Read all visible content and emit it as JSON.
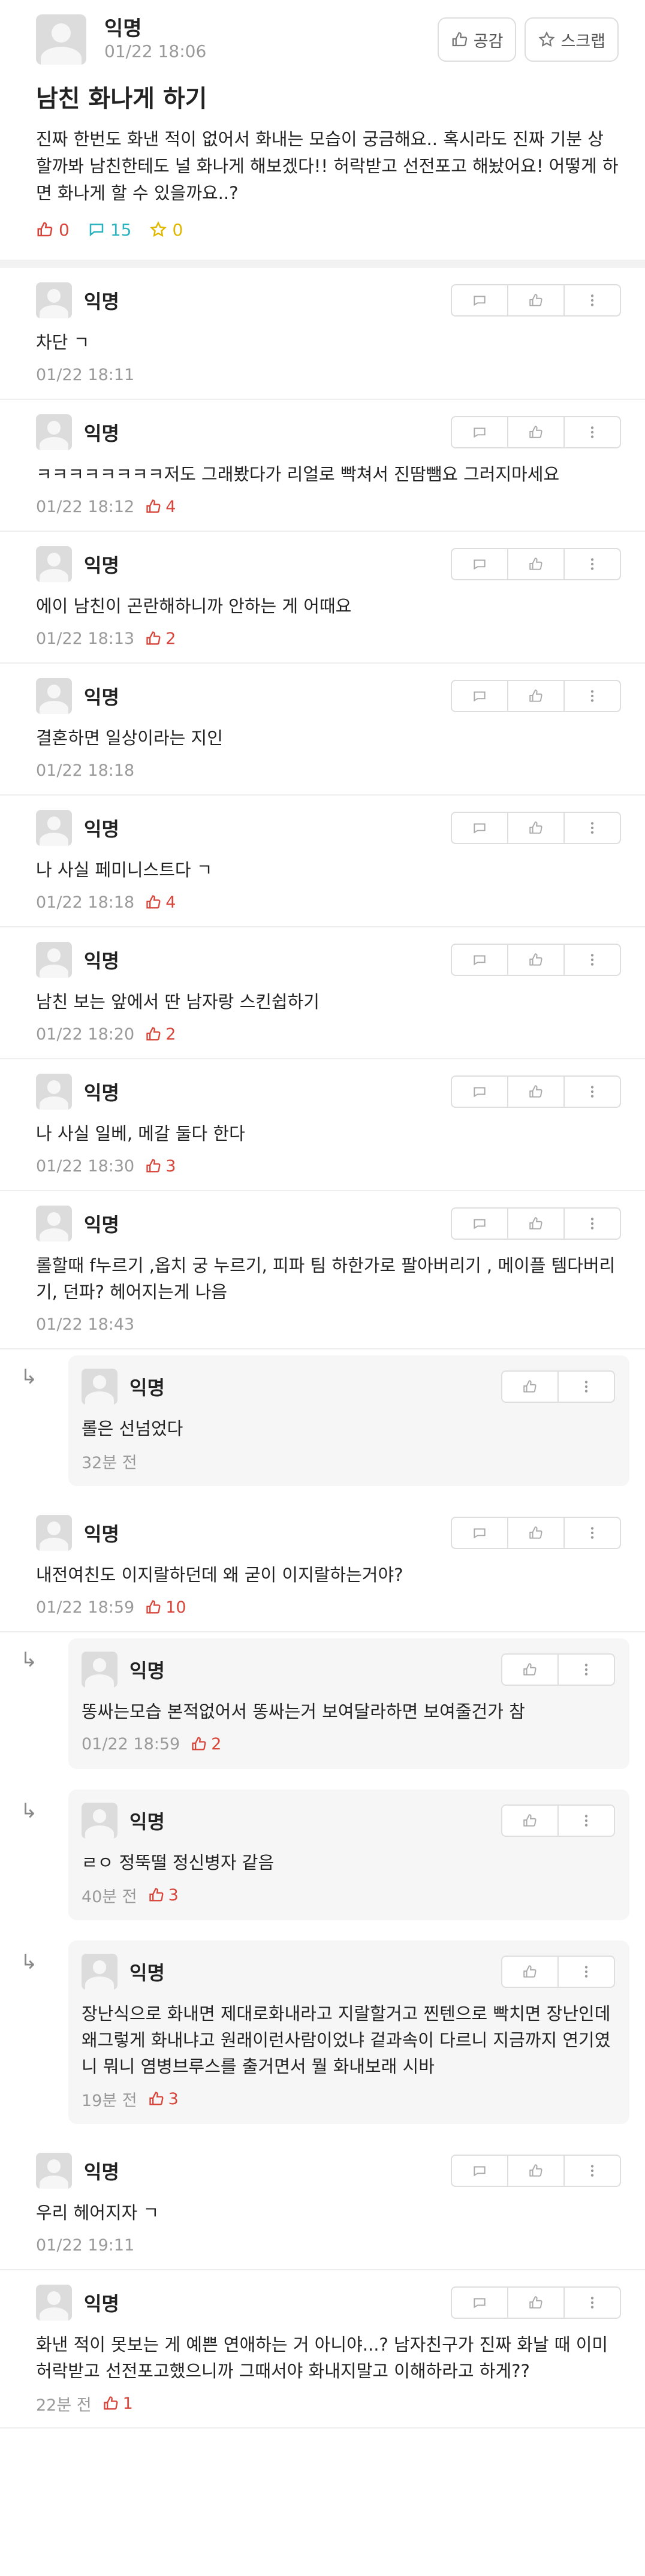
{
  "post": {
    "author": "익명",
    "time": "01/22 18:06",
    "like_button": "공감",
    "scrap_button": "스크랩",
    "title": "남친 화나게 하기",
    "content": "진짜 한번도 화낸 적이 없어서 화내는 모습이 궁금해요.. 혹시라도 진짜 기분 상할까봐 남친한테도 널 화나게 해보겠다!! 허락받고 선전포고 해놨어요! 어떻게 하면 화나게 할 수 있을까요..?",
    "like_count": "0",
    "comment_count": "15",
    "scrap_count": "0"
  },
  "comments": [
    {
      "author": "익명",
      "text": "차단 ㄱ",
      "time": "01/22 18:11",
      "likes": ""
    },
    {
      "author": "익명",
      "text": "ㅋㅋㅋㅋㅋㅋㅋㅋ저도 그래봤다가 리얼로 빡쳐서 진땀뺌요 그러지마세요",
      "time": "01/22 18:12",
      "likes": "4"
    },
    {
      "author": "익명",
      "text": "에이 남친이 곤란해하니까 안하는 게 어때요",
      "time": "01/22 18:13",
      "likes": "2"
    },
    {
      "author": "익명",
      "text": "결혼하면 일상이라는 지인",
      "time": "01/22 18:18",
      "likes": ""
    },
    {
      "author": "익명",
      "text": "나 사실 페미니스트다 ㄱ",
      "time": "01/22 18:18",
      "likes": "4"
    },
    {
      "author": "익명",
      "text": "남친 보는 앞에서 딴 남자랑 스킨쉽하기",
      "time": "01/22 18:20",
      "likes": "2"
    },
    {
      "author": "익명",
      "text": "나 사실 일베, 메갈 둘다 한다",
      "time": "01/22 18:30",
      "likes": "3"
    },
    {
      "author": "익명",
      "text": "롤할때 f누르기 ,옵치 궁 누르기, 피파 팀 하한가로 팔아버리기 , 메이플 템다버리기, 던파? 헤어지는게 나음",
      "time": "01/22 18:43",
      "likes": ""
    }
  ],
  "reply1": {
    "author": "익명",
    "text": "롤은 선넘었다",
    "time": "32분 전",
    "likes": ""
  },
  "comment9": {
    "author": "익명",
    "text": "내전여친도 이지랄하던데 왜 굳이 이지랄하는거야?",
    "time": "01/22 18:59",
    "likes": "10"
  },
  "replies2": [
    {
      "author": "익명",
      "text": "똥싸는모습 본적없어서 똥싸는거 보여달라하면 보여줄건가 참",
      "time": "01/22 18:59",
      "likes": "2"
    },
    {
      "author": "익명",
      "text": "ㄹㅇ 정뚝떨 정신병자 같음",
      "time": "40분 전",
      "likes": "3"
    },
    {
      "author": "익명",
      "text": "장난식으로 화내면 제대로화내라고 지랄할거고 찐텐으로 빡치면 장난인데 왜그렇게 화내냐고 원래이런사람이었냐 겉과속이 다르니 지금까지 연기였니 뭐니 염병브루스를 출거면서 뭘 화내보래 시바",
      "time": "19분 전",
      "likes": "3"
    }
  ],
  "tail": [
    {
      "author": "익명",
      "text": "우리 헤어지자 ㄱ",
      "time": "01/22 19:11",
      "likes": ""
    },
    {
      "author": "익명",
      "text": "화낸 적이 못보는 게 예쁜 연애하는 거 아니야...? 남자친구가 진짜 화날 때 이미 허락받고 선전포고했으니까 그때서야 화내지말고 이해하라고 하게??",
      "time": "22분 전",
      "likes": "1"
    }
  ],
  "reply_arrow": "↳",
  "colors": {
    "like": "#d8453a",
    "comment": "#2bb3c0",
    "scrap": "#e0b800"
  }
}
